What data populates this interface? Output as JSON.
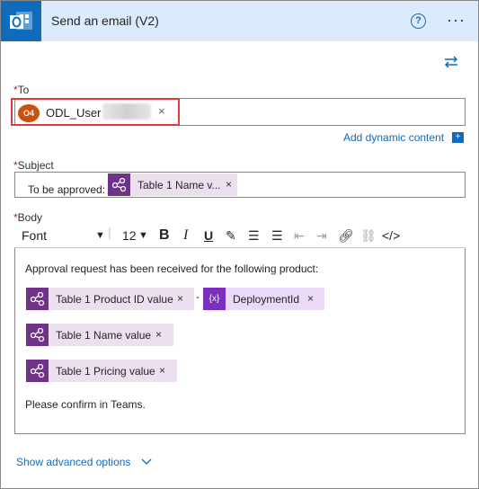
{
  "header": {
    "title": "Send an email (V2)",
    "help_label": "?",
    "more_label": "···",
    "app_icon": "outlook-icon"
  },
  "to": {
    "label": "To",
    "required_mark": "*",
    "user_initials": "O4",
    "user_name": "ODL_User",
    "remove_label": "×"
  },
  "dynamic_content": {
    "label": "Add dynamic content",
    "plus": "+"
  },
  "subject": {
    "label": "Subject",
    "required_mark": "*",
    "prefix": "To be approved:",
    "token": "Table 1 Name v...",
    "remove_label": "×"
  },
  "body": {
    "label": "Body",
    "required_mark": "*",
    "toolbar": {
      "font": "Font",
      "size": "12",
      "bold": "B",
      "italic": "I",
      "underline": "U",
      "code": "</>"
    },
    "intro": "Approval request has been received for the following product:",
    "separator": "-",
    "tokens": [
      {
        "text": "Table 1 Product ID value",
        "remove": "×"
      },
      {
        "text": "DeploymentId",
        "remove": "×",
        "icon": "{x}"
      },
      {
        "text": "Table 1 Name value",
        "remove": "×"
      },
      {
        "text": "Table 1 Pricing value",
        "remove": "×"
      }
    ],
    "closing": "Please confirm in Teams."
  },
  "advanced": {
    "label": "Show advanced options"
  },
  "colors": {
    "accent": "#0f6cbd",
    "header_bg": "#dcebfb",
    "token_bg": "#ecdff0",
    "token_icon": "#6e3289",
    "highlight": "#e6393e"
  }
}
